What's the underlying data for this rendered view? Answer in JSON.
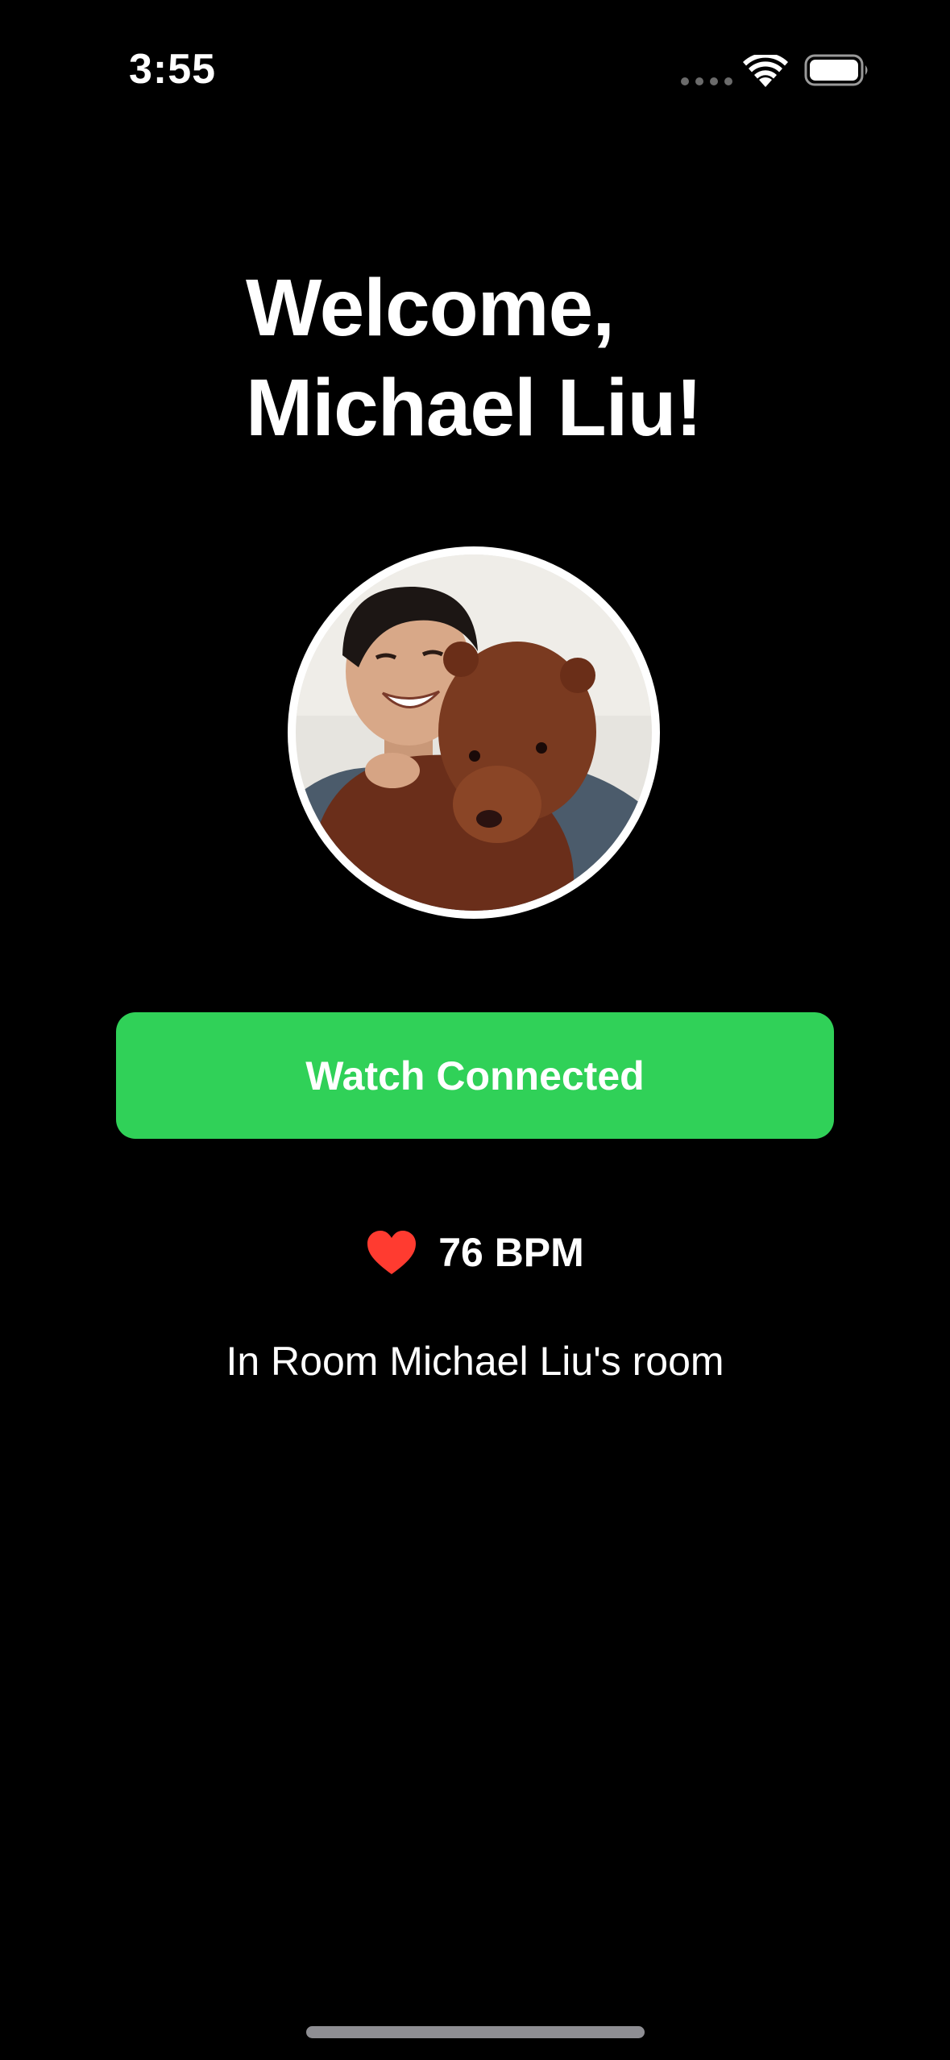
{
  "status_bar": {
    "time": "3:55",
    "wifi_icon": "wifi-icon",
    "battery_icon": "battery-icon"
  },
  "welcome": {
    "line1": "Welcome,",
    "line2": "Michael Liu!"
  },
  "avatar": {
    "icon": "profile-photo"
  },
  "watch_button": {
    "label": "Watch Connected",
    "color": "#30D158"
  },
  "heart_rate": {
    "icon": "heart-icon",
    "value": "76 BPM",
    "color": "#FF3B30"
  },
  "room": {
    "text": "In Room Michael Liu's room"
  }
}
